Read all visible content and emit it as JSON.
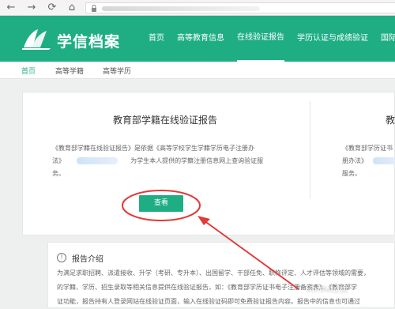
{
  "header": {
    "logo_text": "学信档案",
    "nav": [
      "首页",
      "高等教育信息",
      "在线验证报告",
      "学历认证与成绩验证",
      "国际合"
    ]
  },
  "subnav": [
    "首页",
    "高等学籍",
    "高等学历"
  ],
  "left_card": {
    "title": "教育部学籍在线验证报告",
    "desc_line1": "《教育部学籍在线验证报告》是依据《高等学校学生学籍学历电子注册办",
    "desc_line2_prefix": "法》",
    "desc_line2_suffix": "为学生本人提供的学籍注册信息网上查询验证服",
    "desc_line3": "务。",
    "button": "查看"
  },
  "right_card": {
    "title_fragment": "教",
    "desc_line1": "《教育部学历证书",
    "desc_line2": "册办法》",
    "desc_line3": "服务。"
  },
  "intro": {
    "icon": "info-icon",
    "title": "报告介绍",
    "line1": "为满足求职招聘、派遣接收、升学（考研、专升本）、出国留学、干部任免、职称评定、人才评估等领域的需要，",
    "line2": "的学籍、学历、招生录取等相关信息提供在线验证报告，如：《教育部学历证书电子注册备案表》、《教育部学",
    "line3": "证功能，报告持有人登录网站在线验证页面，输入在线验证码即可免费验证报告内容。报告中的信息也可通过"
  },
  "watermark": "Baidu经验",
  "colors": {
    "brand": "#1fae84",
    "annotation": "#e03a3a"
  }
}
